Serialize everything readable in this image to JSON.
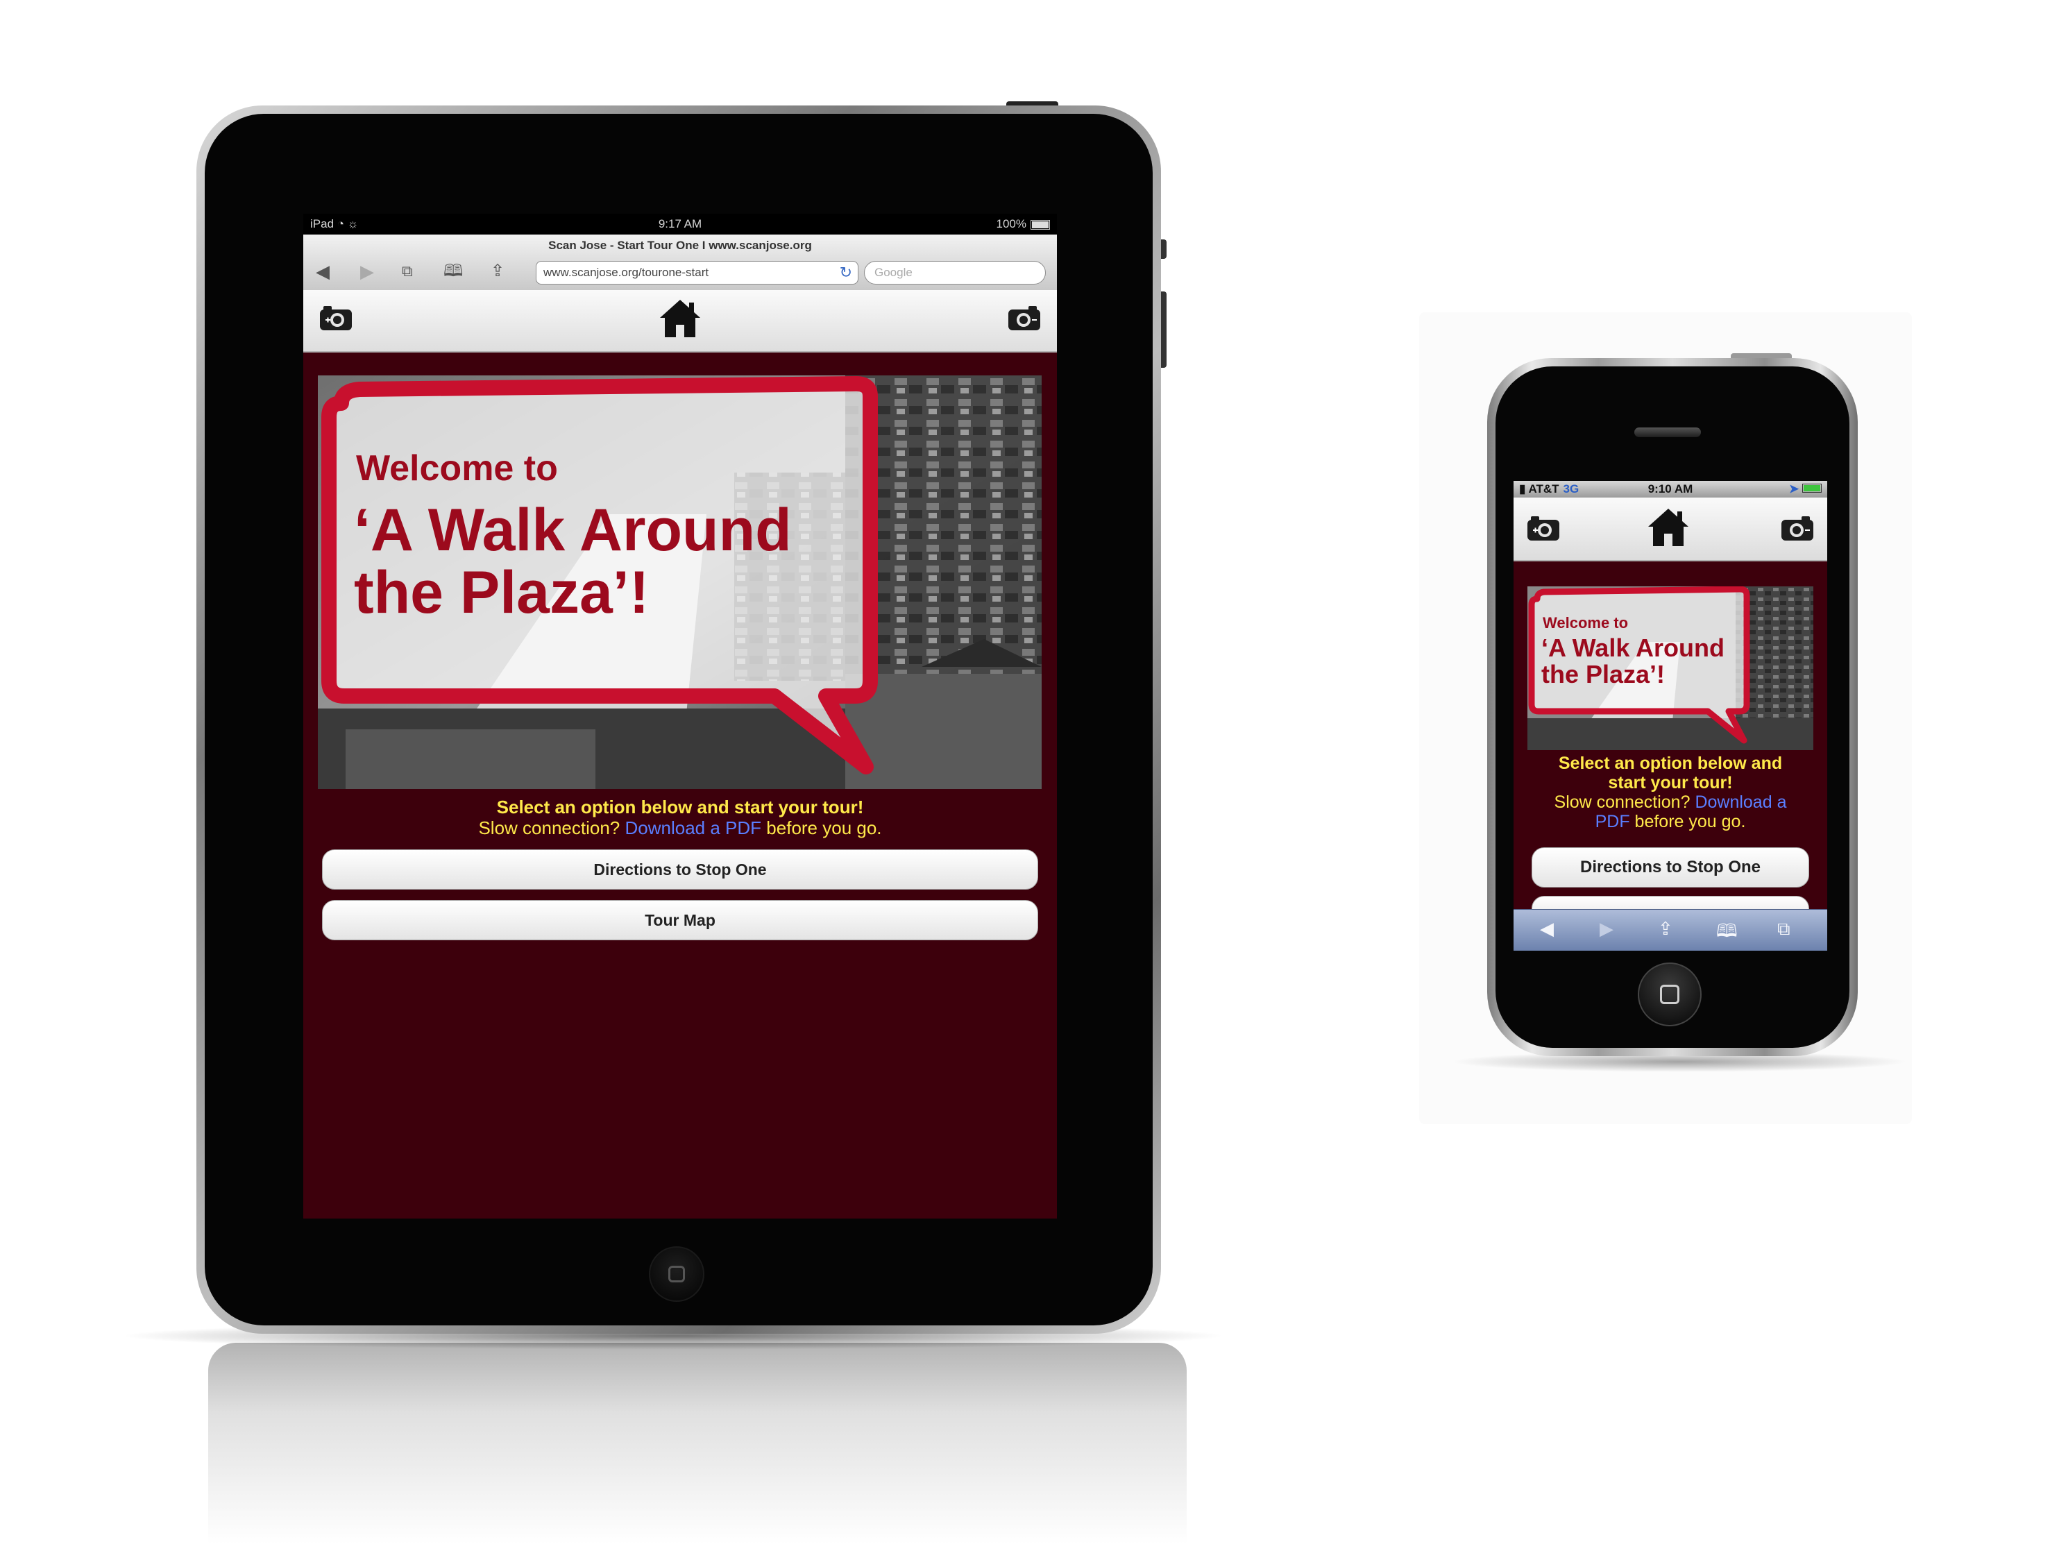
{
  "ipad": {
    "status": {
      "carrier": "iPad",
      "time": "9:17 AM",
      "battery": "100%"
    },
    "browser": {
      "page_title": "Scan Jose - Start Tour One I www.scanjose.org",
      "url": "www.scanjose.org/tourone-start",
      "search_placeholder": "Google"
    },
    "hero": {
      "welcome": "Welcome to",
      "title_line1": "‘A Walk Around",
      "title_line2": "the Plaza’!"
    },
    "message": {
      "headline": "Select an option below and start your tour!",
      "slow_prefix": "Slow connection?",
      "link": "Download a PDF",
      "slow_suffix": "before you go."
    },
    "buttons": {
      "directions": "Directions to Stop One",
      "tour_map": "Tour Map"
    }
  },
  "iphone": {
    "status": {
      "carrier": "AT&T",
      "network": "3G",
      "time": "9:10 AM"
    },
    "hero": {
      "welcome": "Welcome to",
      "title_line1": "‘A Walk Around",
      "title_line2": "the Plaza’!"
    },
    "message": {
      "headline_line1": "Select an option below and",
      "headline_line2": "start your tour!",
      "slow_prefix": "Slow connection?",
      "link_part1": "Download a",
      "link_part2": "PDF",
      "slow_suffix": "before you go."
    },
    "buttons": {
      "directions": "Directions to Stop One"
    }
  },
  "colors": {
    "page_background": "#3d000c",
    "brand_red": "#c8102e",
    "headline_yellow": "#ffe94a",
    "link_blue": "#5a7fff"
  },
  "icons": [
    "camera-left-icon",
    "home-icon",
    "camera-right-icon",
    "back-icon",
    "forward-icon",
    "tabs-icon",
    "bookmarks-icon",
    "share-icon",
    "reload-icon"
  ]
}
